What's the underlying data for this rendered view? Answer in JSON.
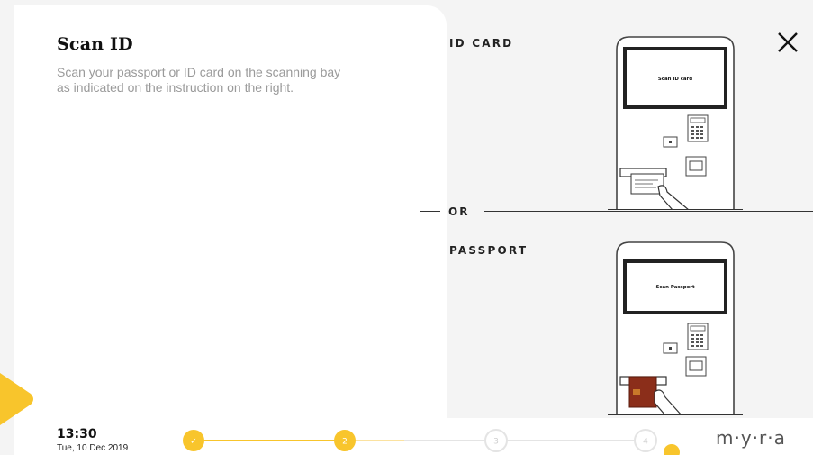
{
  "panel": {
    "title": "Scan ID",
    "description": "Scan your passport or ID card on the scanning bay as indicated on the instruction on the right."
  },
  "instructions": {
    "id_card_label": "ID CARD",
    "or_label": "OR",
    "passport_label": "PASSPORT",
    "id_screen_text": "Scan ID card",
    "passport_screen_text": "Scan Passport"
  },
  "footer": {
    "time": "13:30",
    "date": "Tue, 10 Dec 2019",
    "logo": "m·y·r·a"
  },
  "progress": {
    "steps": [
      {
        "label": "✓",
        "state": "done"
      },
      {
        "label": "2",
        "state": "current"
      },
      {
        "label": "3",
        "state": "upcoming"
      },
      {
        "label": "4",
        "state": "upcoming"
      }
    ],
    "fraction": 0.38
  },
  "colors": {
    "accent": "#f8c52c",
    "accent_light": "#fbe2a0",
    "upcoming": "#e4e4e4",
    "passport": "#8b2e1a"
  },
  "icons": {
    "close": "close-icon",
    "play": "play-icon"
  }
}
